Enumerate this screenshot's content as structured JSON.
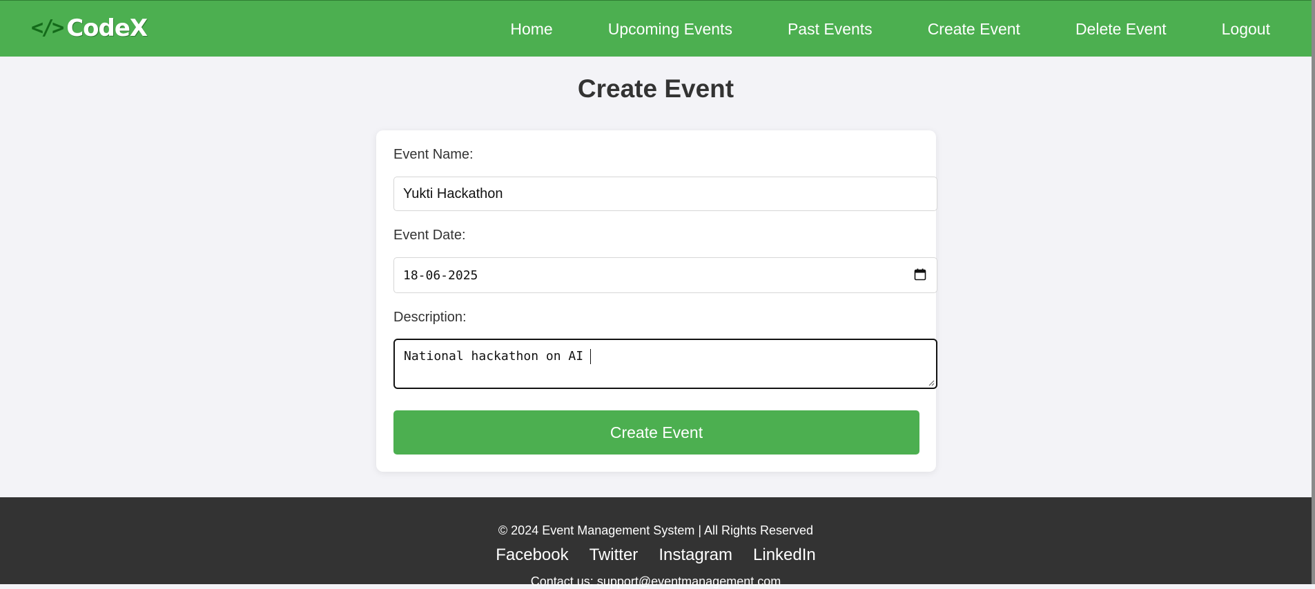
{
  "brand": {
    "mark": "</>",
    "name": "CodeX"
  },
  "nav": {
    "items": [
      {
        "label": "Home"
      },
      {
        "label": "Upcoming Events"
      },
      {
        "label": "Past Events"
      },
      {
        "label": "Create Event"
      },
      {
        "label": "Delete Event"
      },
      {
        "label": "Logout"
      }
    ]
  },
  "page": {
    "title": "Create Event"
  },
  "form": {
    "event_name": {
      "label": "Event Name:",
      "value": "Yukti Hackathon"
    },
    "event_date": {
      "label": "Event Date:",
      "value": "18-06-2025",
      "icon": "calendar-icon"
    },
    "description": {
      "label": "Description:",
      "value": "National hackathon on AI"
    },
    "submit_label": "Create Event"
  },
  "footer": {
    "copyright": "© 2024 Event Management System | All Rights Reserved",
    "social": [
      {
        "label": "Facebook"
      },
      {
        "label": "Twitter"
      },
      {
        "label": "Instagram"
      },
      {
        "label": "LinkedIn"
      }
    ],
    "contact": "Contact us: support@eventmanagement.com"
  },
  "colors": {
    "primary": "#4caf50",
    "footer_bg": "#333333",
    "page_bg": "#f3f3f7"
  }
}
